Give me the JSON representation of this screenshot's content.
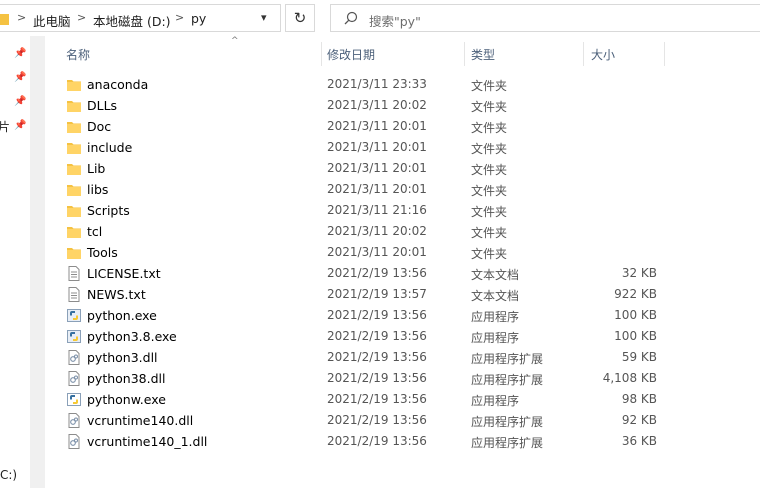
{
  "address": {
    "crumbs": [
      "此电脑",
      "本地磁盘 (D:)",
      "py"
    ],
    "separator": ">",
    "refresh_icon": "↻"
  },
  "search": {
    "placeholder": "搜索\"py\""
  },
  "nav": {
    "partial_label_1": "片",
    "partial_label_2": "C:)"
  },
  "columns": {
    "name": "名称",
    "date": "修改日期",
    "type": "类型",
    "size": "大小"
  },
  "files": [
    {
      "name": "anaconda",
      "date": "2021/3/11 23:33",
      "type": "文件夹",
      "size": "",
      "icon": "folder-icon"
    },
    {
      "name": "DLLs",
      "date": "2021/3/11 20:02",
      "type": "文件夹",
      "size": "",
      "icon": "folder-icon"
    },
    {
      "name": "Doc",
      "date": "2021/3/11 20:01",
      "type": "文件夹",
      "size": "",
      "icon": "folder-icon"
    },
    {
      "name": "include",
      "date": "2021/3/11 20:01",
      "type": "文件夹",
      "size": "",
      "icon": "folder-icon"
    },
    {
      "name": "Lib",
      "date": "2021/3/11 20:01",
      "type": "文件夹",
      "size": "",
      "icon": "folder-icon"
    },
    {
      "name": "libs",
      "date": "2021/3/11 20:01",
      "type": "文件夹",
      "size": "",
      "icon": "folder-icon"
    },
    {
      "name": "Scripts",
      "date": "2021/3/11 21:16",
      "type": "文件夹",
      "size": "",
      "icon": "folder-icon"
    },
    {
      "name": "tcl",
      "date": "2021/3/11 20:02",
      "type": "文件夹",
      "size": "",
      "icon": "folder-icon"
    },
    {
      "name": "Tools",
      "date": "2021/3/11 20:01",
      "type": "文件夹",
      "size": "",
      "icon": "folder-icon"
    },
    {
      "name": "LICENSE.txt",
      "date": "2021/2/19 13:56",
      "type": "文本文档",
      "size": "32 KB",
      "icon": "text-file-icon"
    },
    {
      "name": "NEWS.txt",
      "date": "2021/2/19 13:57",
      "type": "文本文档",
      "size": "922 KB",
      "icon": "text-file-icon"
    },
    {
      "name": "python.exe",
      "date": "2021/2/19 13:56",
      "type": "应用程序",
      "size": "100 KB",
      "icon": "python-exe-icon"
    },
    {
      "name": "python3.8.exe",
      "date": "2021/2/19 13:56",
      "type": "应用程序",
      "size": "100 KB",
      "icon": "python-exe-icon"
    },
    {
      "name": "python3.dll",
      "date": "2021/2/19 13:56",
      "type": "应用程序扩展",
      "size": "59 KB",
      "icon": "dll-file-icon"
    },
    {
      "name": "python38.dll",
      "date": "2021/2/19 13:56",
      "type": "应用程序扩展",
      "size": "4,108 KB",
      "icon": "dll-file-icon"
    },
    {
      "name": "pythonw.exe",
      "date": "2021/2/19 13:56",
      "type": "应用程序",
      "size": "98 KB",
      "icon": "pythonw-exe-icon"
    },
    {
      "name": "vcruntime140.dll",
      "date": "2021/2/19 13:56",
      "type": "应用程序扩展",
      "size": "92 KB",
      "icon": "dll-file-icon"
    },
    {
      "name": "vcruntime140_1.dll",
      "date": "2021/2/19 13:56",
      "type": "应用程序扩展",
      "size": "36 KB",
      "icon": "dll-file-icon"
    }
  ],
  "colors": {
    "folder": "#f5c242",
    "header_text": "#4c607a",
    "detail_text": "#555555"
  }
}
